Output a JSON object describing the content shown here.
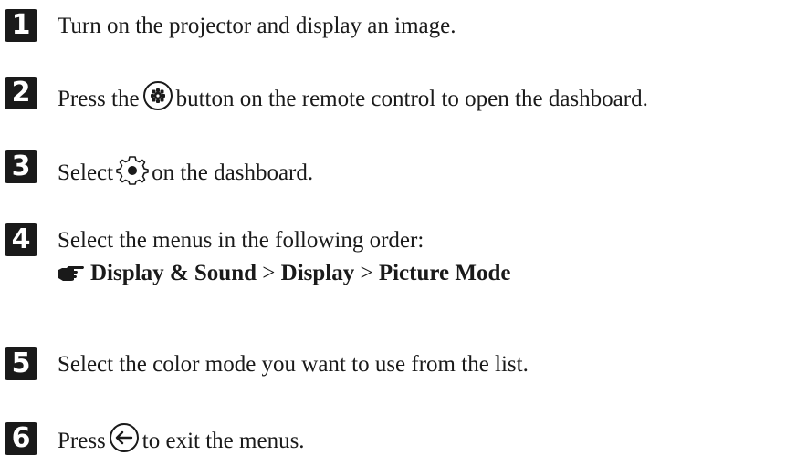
{
  "steps": [
    {
      "number": "1",
      "text": "Turn on the projector and display an image."
    },
    {
      "number": "2",
      "before": "Press the",
      "after": "button on the remote control to open the dashboard.",
      "icon": "home-button-icon"
    },
    {
      "number": "3",
      "before": "Select",
      "after": "on the dashboard.",
      "icon": "settings-gear-icon"
    },
    {
      "number": "4",
      "text": "Select the menus in the following order:",
      "menu_path": {
        "item1": "Display & Sound",
        "sep1": ">",
        "item2": "Display",
        "sep2": ">",
        "item3": "Picture Mode"
      }
    },
    {
      "number": "5",
      "text": "Select the color mode you want to use from the list."
    },
    {
      "number": "6",
      "before": "Press",
      "after": "to exit the menus.",
      "icon": "back-button-icon"
    }
  ]
}
